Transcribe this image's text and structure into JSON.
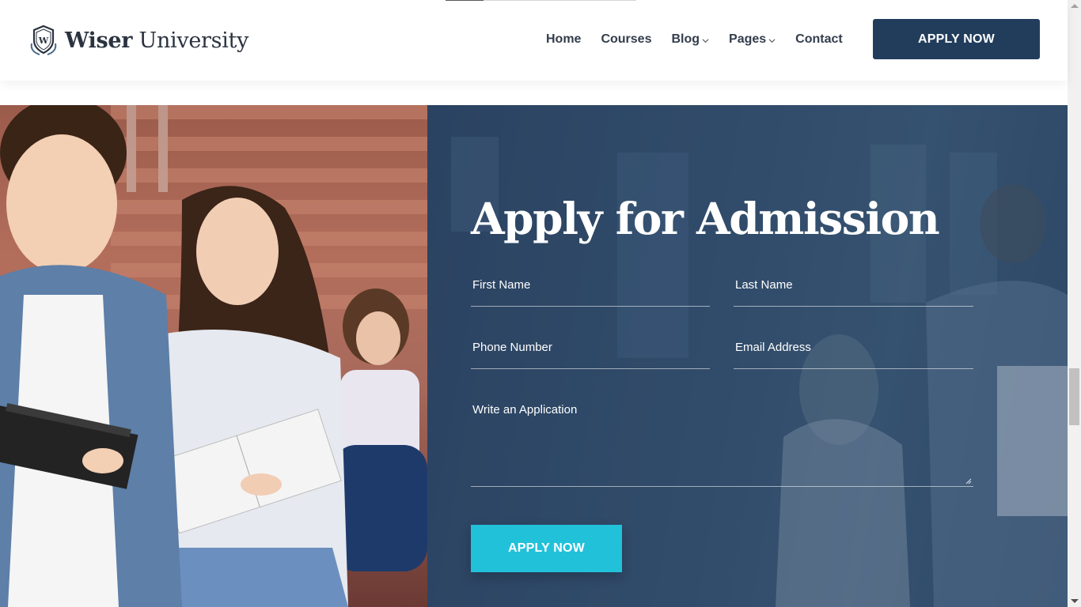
{
  "brand": {
    "name_bold": "Wiser",
    "name_rest": "University",
    "logo_icon": "shield-laurel-icon"
  },
  "nav": {
    "items": [
      {
        "label": "Home",
        "has_dropdown": false
      },
      {
        "label": "Courses",
        "has_dropdown": false
      },
      {
        "label": "Blog",
        "has_dropdown": true
      },
      {
        "label": "Pages",
        "has_dropdown": true
      },
      {
        "label": "Contact",
        "has_dropdown": false
      }
    ],
    "apply_button": "APPLY NOW"
  },
  "form": {
    "title": "Apply for Admission",
    "first_name_placeholder": "First Name",
    "last_name_placeholder": "Last Name",
    "phone_placeholder": "Phone Number",
    "email_placeholder": "Email Address",
    "application_placeholder": "Write an Application",
    "submit_label": "APPLY NOW"
  },
  "colors": {
    "header_button": "#223d5c",
    "panel_overlay": "#2a4160",
    "submit_button": "#22c1da",
    "nav_text": "#333d4c"
  }
}
